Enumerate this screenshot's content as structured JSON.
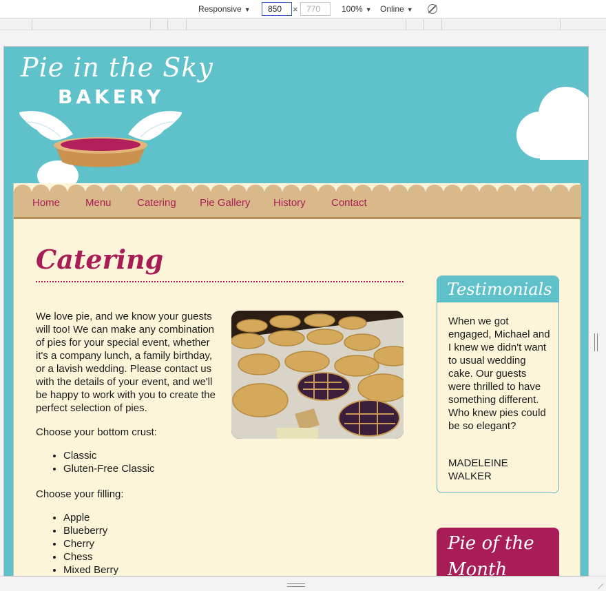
{
  "devtools": {
    "device": "Responsive",
    "width": "850",
    "height": "770",
    "zoom": "100%",
    "network": "Online",
    "times": "×"
  },
  "site": {
    "logo_title": "Pie in the Sky",
    "logo_subtitle": "BAKERY"
  },
  "nav": [
    {
      "label": "Home"
    },
    {
      "label": "Menu"
    },
    {
      "label": "Catering"
    },
    {
      "label": "Pie Gallery"
    },
    {
      "label": "History"
    },
    {
      "label": "Contact"
    }
  ],
  "page": {
    "title": "Catering",
    "intro": "We love pie, and we know your guests will too! We can make any combination of pies for your special event, whether it's a company lunch, a family birthday, or a lavish wedding. Please contact us with the details of your event, and we'll be happy to work with you to create the perfect selection of pies.",
    "crust_label": "Choose your bottom crust:",
    "crusts": [
      "Classic",
      "Gluten-Free Classic"
    ],
    "filling_label": "Choose your filling:",
    "fillings": [
      "Apple",
      "Blueberry",
      "Cherry",
      "Chess",
      "Mixed Berry"
    ]
  },
  "sidebar": {
    "testimonials_title": "Testimonials",
    "testimonial_quote": "When we got engaged, Michael and I knew we didn't want to usual wedding cake. Our guests were thrilled to have something different. Who knew pies could be so elegant?",
    "testimonial_author": "Madeleine Walker",
    "pie_of_month_title": "Pie of the Month"
  },
  "colors": {
    "sky": "#5fc1ca",
    "cream": "#fdf5da",
    "crust": "#d9b98a",
    "berry": "#a81d55"
  }
}
